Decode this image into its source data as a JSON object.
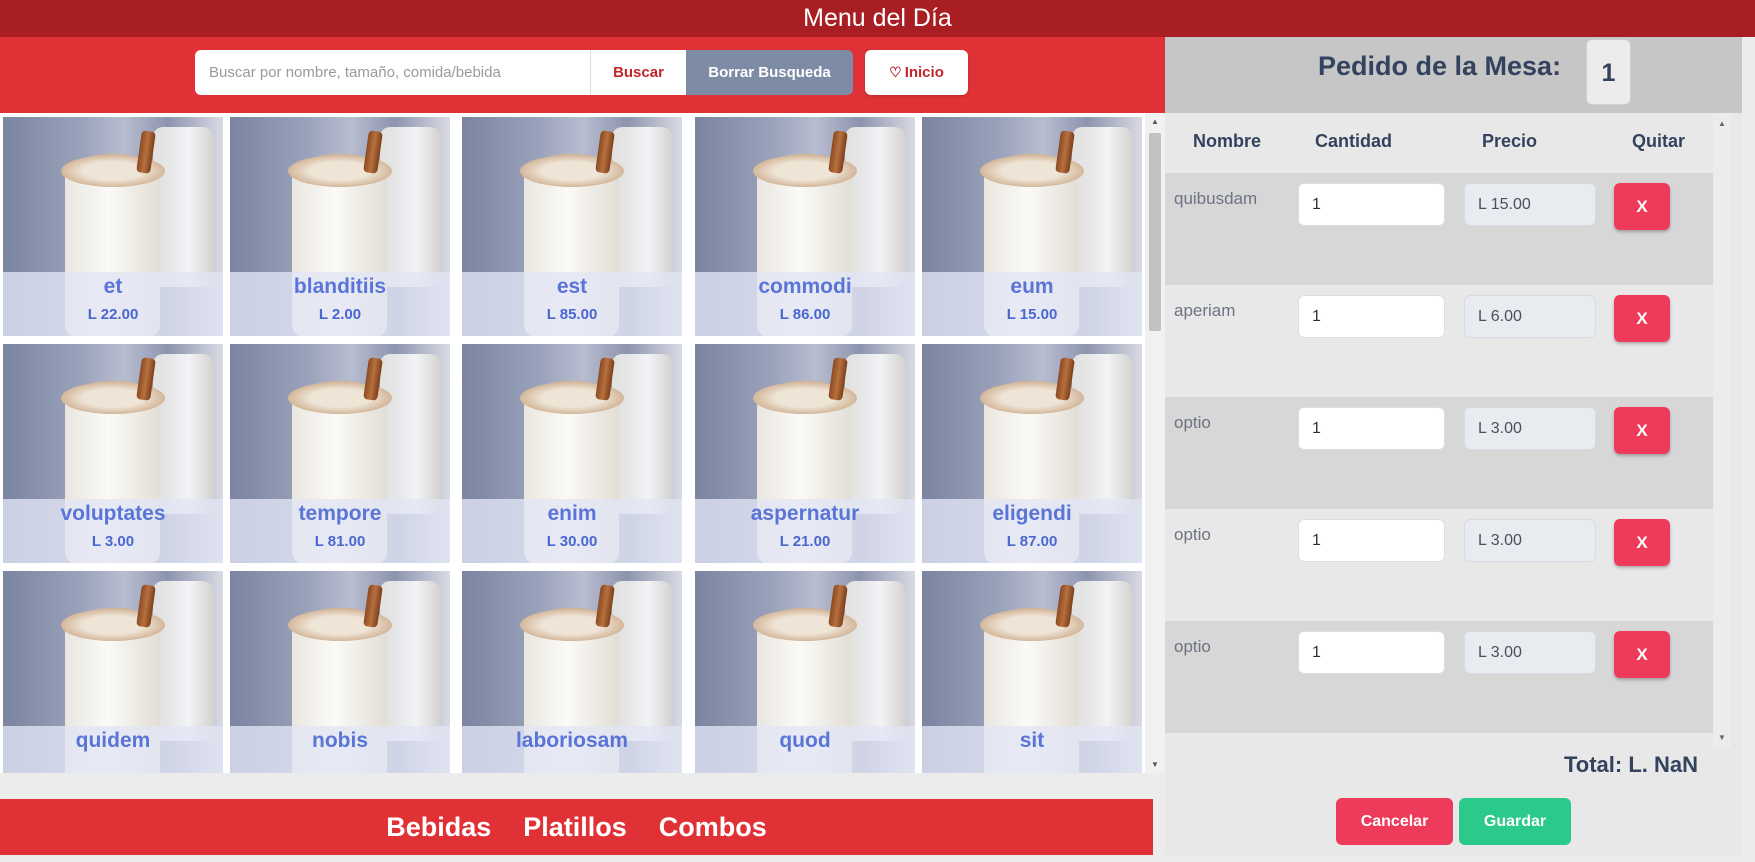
{
  "app": {
    "title": "Menu del Día"
  },
  "search": {
    "placeholder": "Buscar por nombre, tamaño, comida/bebida",
    "value": "",
    "search_label": "Buscar",
    "clear_label": "Borrar Busqueda",
    "home_label": "Inicio",
    "home_icon": "heart-icon"
  },
  "menu_items": [
    {
      "name": "et",
      "price": "L 22.00"
    },
    {
      "name": "blanditiis",
      "price": "L 2.00"
    },
    {
      "name": "est",
      "price": "L 85.00"
    },
    {
      "name": "commodi",
      "price": "L 86.00"
    },
    {
      "name": "eum",
      "price": "L 15.00"
    },
    {
      "name": "voluptates",
      "price": "L 3.00"
    },
    {
      "name": "tempore",
      "price": "L 81.00"
    },
    {
      "name": "enim",
      "price": "L 30.00"
    },
    {
      "name": "aspernatur",
      "price": "L 21.00"
    },
    {
      "name": "eligendi",
      "price": "L 87.00"
    },
    {
      "name": "quidem",
      "price": ""
    },
    {
      "name": "nobis",
      "price": ""
    },
    {
      "name": "laboriosam",
      "price": ""
    },
    {
      "name": "quod",
      "price": ""
    },
    {
      "name": "sit",
      "price": ""
    }
  ],
  "categories": [
    "Bebidas",
    "Platillos",
    "Combos"
  ],
  "order": {
    "title": "Pedido de la Mesa:",
    "table_number": "1",
    "columns": {
      "name": "Nombre",
      "qty": "Cantidad",
      "price": "Precio",
      "remove": "Quitar"
    },
    "rows": [
      {
        "name": "quibusdam",
        "qty": "1",
        "price": "L 15.00",
        "remove": "X"
      },
      {
        "name": "aperiam",
        "qty": "1",
        "price": "L 6.00",
        "remove": "X"
      },
      {
        "name": "optio",
        "qty": "1",
        "price": "L 3.00",
        "remove": "X"
      },
      {
        "name": "optio",
        "qty": "1",
        "price": "L 3.00",
        "remove": "X"
      },
      {
        "name": "optio",
        "qty": "1",
        "price": "L 3.00",
        "remove": "X"
      }
    ],
    "total": "Total: L. NaN",
    "cancel_label": "Cancelar",
    "save_label": "Guardar"
  },
  "colors": {
    "header": "#a81e22",
    "bar": "#e03236",
    "accent": "#5a74d8",
    "danger": "#ee3b5c",
    "success": "#2bc98a"
  }
}
